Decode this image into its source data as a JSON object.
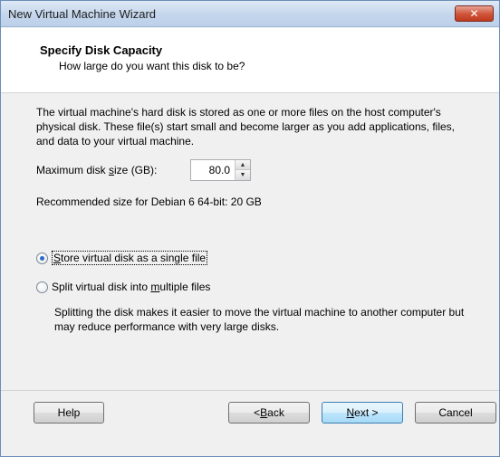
{
  "window": {
    "title": "New Virtual Machine Wizard",
    "close_glyph": "✕"
  },
  "header": {
    "title": "Specify Disk Capacity",
    "subtitle": "How large do you want this disk to be?"
  },
  "description": "The virtual machine's hard disk is stored as one or more files on the host computer's physical disk. These file(s) start small and become larger as you add applications, files, and data to your virtual machine.",
  "disk_size": {
    "label_before": "Maximum disk ",
    "label_accel": "s",
    "label_after": "ize (GB):",
    "value": "80.0"
  },
  "recommended": "Recommended size for Debian 6 64-bit: 20 GB",
  "options": {
    "single": {
      "before": "",
      "accel": "S",
      "after": "tore virtual disk as a single file",
      "checked": true
    },
    "split": {
      "before": "Split virtual disk into ",
      "accel": "m",
      "after": "ultiple files",
      "checked": false
    }
  },
  "split_description": "Splitting the disk makes it easier to move the virtual machine to another computer but may reduce performance with very large disks.",
  "buttons": {
    "help": "Help",
    "back": {
      "before": "< ",
      "accel": "B",
      "after": "ack"
    },
    "next": {
      "before": "",
      "accel": "N",
      "after": "ext >"
    },
    "cancel": "Cancel"
  }
}
